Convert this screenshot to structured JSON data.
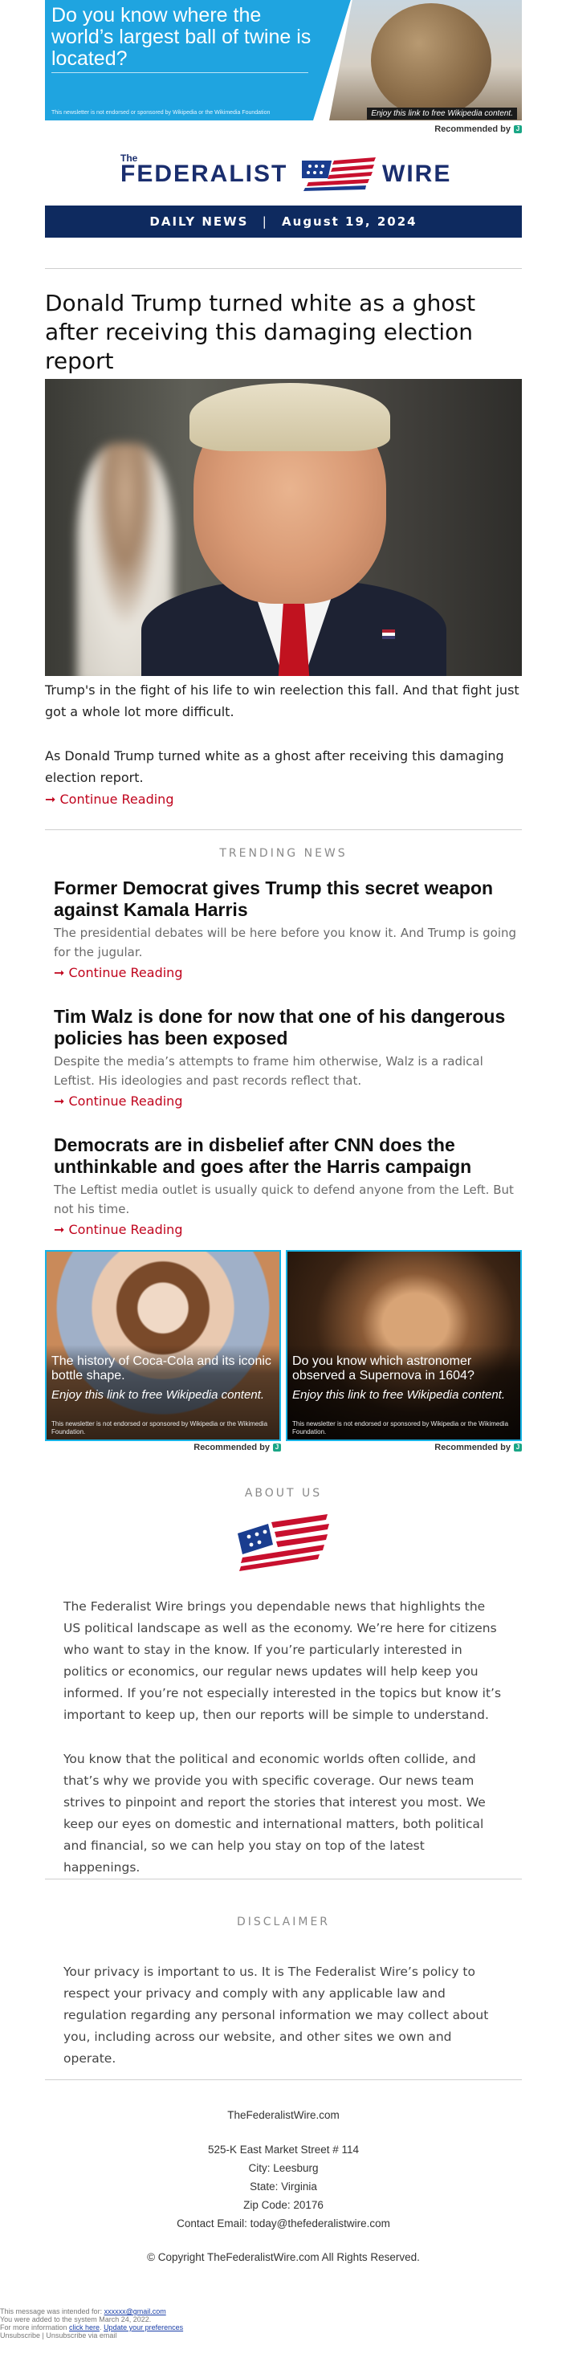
{
  "top_ad": {
    "headline": "Do you know where the world’s largest ball of twine is located?",
    "disclaimer": "This newsletter is not endorsed or sponsored by Wikipedia or the Wikimedia Foundation",
    "cta": "Enjoy this link to free Wikipedia content.",
    "recommended": "Recommended by"
  },
  "logo": {
    "the": "The",
    "name_left": "FEDERALIST",
    "name_right": "WIRE"
  },
  "banner": {
    "left": "DAILY NEWS",
    "sep": "|",
    "date": "August 19, 2024"
  },
  "main_story": {
    "title": "Donald Trump turned white as a ghost after receiving this damaging election report",
    "para1": "Trump's in the fight of his life to win reelection this fall. And that fight just got a whole lot more difficult.",
    "para2": "As Donald Trump turned white as a ghost after receiving this damaging election report.",
    "continue": "➞ Continue Reading"
  },
  "trending": {
    "label": "TRENDING NEWS",
    "items": [
      {
        "title": "Former Democrat gives Trump this secret weapon against Kamala Harris",
        "summary": "The presidential debates will be here before you know it. And Trump is going for the jugular.",
        "continue": "➞ Continue Reading"
      },
      {
        "title": "Tim Walz is done for now that one of his dangerous policies has been exposed",
        "summary": "Despite the media’s attempts to frame him otherwise, Walz is a radical Leftist. His ideologies and past records reflect that.",
        "continue": "➞ Continue Reading"
      },
      {
        "title": "Democrats are in disbelief after CNN does the unthinkable and goes after the Harris campaign",
        "summary": "The Leftist media outlet is usually quick to defend anyone from the Left. But not his time.",
        "continue": "➞ Continue Reading"
      }
    ]
  },
  "ad_cards": [
    {
      "title": "The history of Coca-Cola and its iconic bottle shape.",
      "cta": "Enjoy this link to free Wikipedia content.",
      "disclaimer": "This newsletter is not endorsed or sponsored by Wikipedia or the Wikimedia Foundation.",
      "recommended": "Recommended by"
    },
    {
      "title": "Do you know which astronomer observed a Supernova in 1604?",
      "cta": "Enjoy this link to free Wikipedia content.",
      "disclaimer": "This newsletter is not endorsed or sponsored by Wikipedia or the Wikimedia Foundation.",
      "recommended": "Recommended by"
    }
  ],
  "about": {
    "label": "ABOUT US",
    "para1": "The Federalist Wire brings you dependable news that highlights the US political landscape as well as the economy. We’re here for citizens who want to stay in the know. If you’re particularly interested in politics or economics, our regular news updates will help keep you informed. If you’re not especially interested in the topics but know it’s important to keep up, then our reports will be simple to understand.",
    "para2": "You know that the political and economic worlds often collide, and that’s why we provide you with specific coverage. Our news team strives to pinpoint and report the stories that interest you most. We keep our eyes on domestic and international matters, both political and financial, so we can help you stay on top of the latest happenings."
  },
  "disclaimer": {
    "label": "DISCLAIMER",
    "text": "Your privacy is important to us. It is The Federalist Wire’s policy to respect your privacy and comply with any applicable law and regulation regarding any personal information we may collect about you, including across our website, and other sites we own and operate."
  },
  "footer": {
    "site": "TheFederalistWire.com",
    "street": "525-K East Market Street # 114",
    "city": "City: Leesburg",
    "state": "State: Virginia",
    "zip": "Zip Code: 20176",
    "email": "Contact Email: today@thefederalistwire.com",
    "copyright": "© Copyright TheFederalistWire.com All Rights Reserved."
  },
  "fine_print": {
    "intended_prefix": "This message was intended for: ",
    "intended_email": "xxxxxx@gmail.com",
    "added": "You were added to the system March 24, 2022.",
    "more_prefix": "For more information ",
    "click_here": "click here",
    "update_prefs": "Update your preferences",
    "unsubscribe": "Unsubscribe | Unsubscribe via email"
  },
  "colors": {
    "navy": "#0e2a5f",
    "brand_blue": "#1a2e6e",
    "link_red": "#c0031c",
    "ad_blue": "#1fa4e0",
    "flag_red": "#c8102e"
  }
}
